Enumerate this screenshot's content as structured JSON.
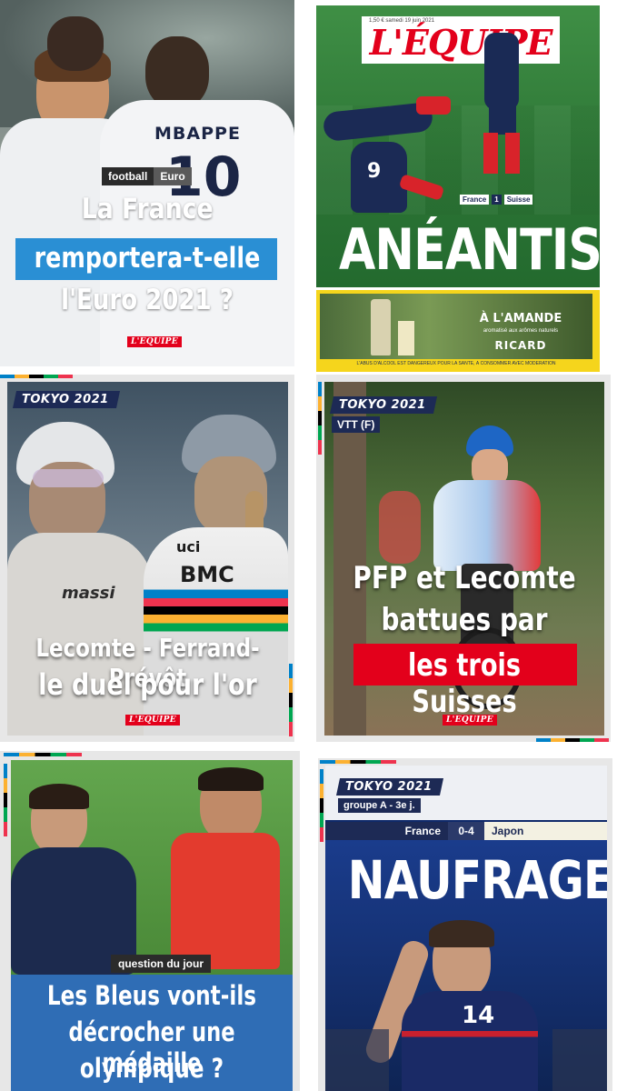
{
  "card1": {
    "tags": [
      "football",
      "Euro"
    ],
    "jersey_name": "MBAPPE",
    "jersey_number": "10",
    "headline": [
      "La France",
      "remportera-t-elle",
      "l'Euro 2021 ?"
    ],
    "logo": "L'EQUIPE",
    "colors": {
      "highlight": "#2a8fd4",
      "tag_bg": "#333333"
    }
  },
  "card2": {
    "masthead": "L'ÉQUIPE",
    "dateline": "1,50 € samedi 19 juin 2021",
    "inset_score": [
      "France",
      "1",
      "Suisse"
    ],
    "headline": "ANÉANTIS",
    "player_number": "9",
    "ad": {
      "title": "À L'AMANDE",
      "brand": "RICARD",
      "subtitle": "aromatisé aux arômes naturels",
      "footer": "L'ABUS D'ALCOOL EST DANGEREUX POUR LA SANTÉ, À CONSOMMER AVEC MODÉRATION"
    }
  },
  "card3": {
    "tag": "TOKYO 2021",
    "headline": [
      "Lecomte - Ferrand-Prévôt",
      "le duel pour l'or"
    ],
    "jersey_brands": [
      "uci",
      "BMC",
      "massi"
    ],
    "logo": "L'EQUIPE"
  },
  "card4": {
    "tag": "TOKYO 2021",
    "subtag": "VTT (F)",
    "headline": [
      "PFP et Lecomte",
      "battues par",
      "les trois Suisses"
    ],
    "logo": "L'EQUIPE",
    "colors": {
      "highlight": "#e3001b"
    }
  },
  "card5": {
    "tag": "question du jour",
    "headline": [
      "Les Bleus vont-ils",
      "décrocher une médaille",
      "olympique ?"
    ],
    "colors": {
      "panel": "#2f6db5"
    }
  },
  "card6": {
    "tag": "TOKYO 2021",
    "subtag": "groupe A - 3e j.",
    "score": {
      "home": "France",
      "result": "0-4",
      "away": "Japon"
    },
    "headline": "NAUFRAGE",
    "player_number": "14"
  }
}
